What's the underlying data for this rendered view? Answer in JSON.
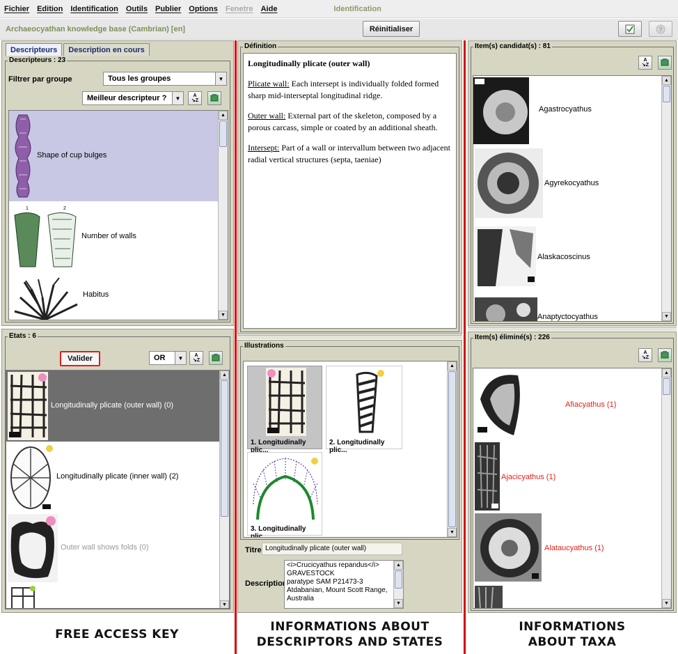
{
  "menu": {
    "items": [
      {
        "label": "Fichier",
        "enabled": true
      },
      {
        "label": "Edition",
        "enabled": true
      },
      {
        "label": "Identification",
        "enabled": true
      },
      {
        "label": "Outils",
        "enabled": true
      },
      {
        "label": "Publier",
        "enabled": true
      },
      {
        "label": "Options",
        "enabled": true
      },
      {
        "label": "Fenetre",
        "enabled": false
      },
      {
        "label": "Aide",
        "enabled": true
      }
    ],
    "mode_label": "Identification"
  },
  "toolbar": {
    "kb_name": "Archaeocyathan knowledge base (Cambrian) [en]",
    "reset_label": "Réinitialiser"
  },
  "left": {
    "tabs": [
      "Descripteurs",
      "Description en cours"
    ],
    "descriptors_legend": "Descripteurs : 23",
    "filter_label": "Filtrer par groupe",
    "group_value": "Tous les groupes",
    "best_value": "Meilleur descripteur ?",
    "descriptors": [
      {
        "label": "Shape of cup bulges",
        "selected": true
      },
      {
        "label": "Number of walls",
        "selected": false
      },
      {
        "label": "Habitus",
        "selected": false
      }
    ],
    "states_legend": "Etats : 6",
    "validate_label": "Valider",
    "operator_value": "OR",
    "states": [
      {
        "label": "Longitudinally plicate (outer wall) (0)",
        "selected": true,
        "disabled": false
      },
      {
        "label": "Longitudinally plicate (inner wall) (2)",
        "selected": false,
        "disabled": false
      },
      {
        "label": "Outer wall shows folds (0)",
        "selected": false,
        "disabled": true
      }
    ]
  },
  "middle": {
    "definition_legend": "Définition",
    "def_title": "Longitudinally plicate (outer wall)",
    "paragraphs": [
      {
        "term": "Plicate wall:",
        "text": " Each intersept is individually folded formed sharp mid-interseptal longitudinal ridge."
      },
      {
        "term": "Outer wall:",
        "text": " External part of the skeleton, composed by a porous carcass, simple or coated by an additional sheath."
      },
      {
        "term": "Intersept:",
        "text": " Part of a wall or intervallum between two adjacent radial vertical structures (septa, taeniae)"
      }
    ],
    "illustrations_legend": "Illustrations",
    "illustrations": [
      {
        "caption": "1. Longitudinally plic...",
        "selected": true
      },
      {
        "caption": "2. Longitudinally plic...",
        "selected": false
      },
      {
        "caption": "3. Longitudinally plic...",
        "selected": false
      }
    ],
    "title_label": "Titre",
    "title_value": "Longitudinally plicate (outer wall)",
    "description_label": "Description",
    "description_lines": [
      "<i>Crucicyathus repandus</i>",
      "GRAVESTOCK",
      "paratype SAM P21473-3",
      "Atdabanian, Mount Scott Range,",
      "Australia"
    ]
  },
  "right": {
    "candidates_legend": "Item(s) candidat(s) : 81",
    "candidates": [
      "Agastrocyathus",
      "Agyrekocyathus",
      "Alaskacoscinus",
      "Anaptyctocyathus"
    ],
    "eliminated_legend": "Item(s) éliminé(s) : 226",
    "eliminated": [
      "Afiacyathus (1)",
      "Ajacicyathus (1)",
      "Alataucyathus (1)"
    ]
  },
  "captions": {
    "left": "FREE ACCESS KEY",
    "middle_1": "INFORMATIONS ABOUT",
    "middle_2": "DESCRIPTORS AND STATES",
    "right_1": "INFORMATIONS",
    "right_2": "ABOUT TAXA"
  },
  "icons": {
    "sort": "sort-az-icon",
    "tool": "green-tool-icon",
    "check": "check-icon",
    "help": "help-icon"
  },
  "colors": {
    "panel_bg": "#d6d6c2",
    "selected_descriptor": "#c8c8e4",
    "selected_state": "#6e6e6e",
    "eliminated_text": "#e0201a",
    "divider": "#d40000"
  }
}
